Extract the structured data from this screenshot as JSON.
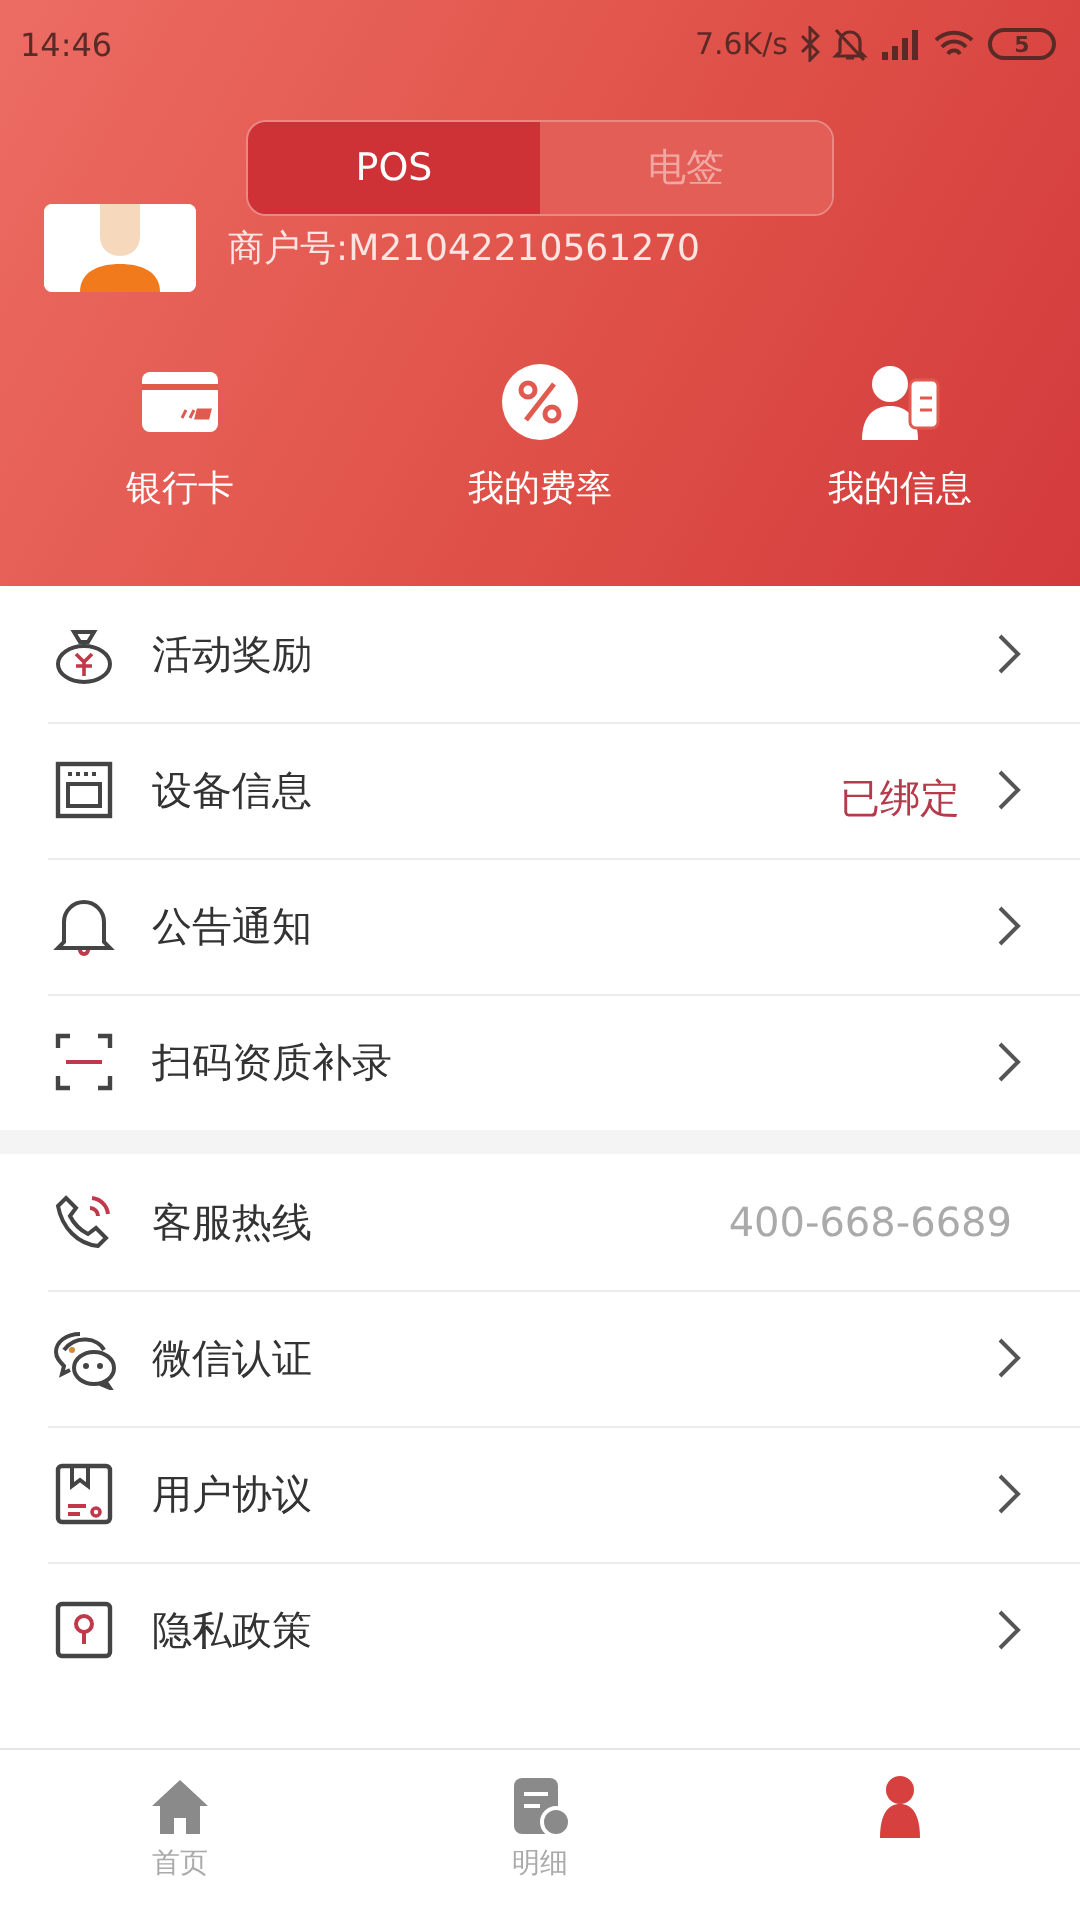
{
  "status_bar": {
    "time": "14:46",
    "network_speed": "7.6K/s",
    "battery": "5"
  },
  "segments": [
    {
      "label": "POS",
      "selected": true
    },
    {
      "label": "电签",
      "selected": false
    }
  ],
  "merchant": {
    "id_text": "商户号:M21042210561270"
  },
  "shortcuts": [
    {
      "label": "银行卡",
      "kind": "card"
    },
    {
      "label": "我的费率",
      "kind": "percent"
    },
    {
      "label": "我的信息",
      "kind": "profile"
    }
  ],
  "menu_groups": [
    {
      "items": [
        {
          "label": "活动奖励",
          "kind": "moneybag",
          "chevron": true
        },
        {
          "label": "设备信息",
          "kind": "device",
          "value": "已绑定",
          "chevron": true
        },
        {
          "label": "公告通知",
          "kind": "bell",
          "chevron": true
        },
        {
          "label": "扫码资质补录",
          "kind": "scan",
          "chevron": true
        }
      ]
    },
    {
      "items": [
        {
          "label": "客服热线",
          "kind": "phone",
          "value": "400-668-6689",
          "chevron": false
        },
        {
          "label": "微信认证",
          "kind": "chat",
          "chevron": true
        },
        {
          "label": "用户协议",
          "kind": "doc",
          "chevron": true
        },
        {
          "label": "隐私政策",
          "kind": "privacy",
          "chevron": true
        }
      ]
    }
  ],
  "bottom_nav": [
    {
      "label": "首页",
      "kind": "home",
      "selected": false
    },
    {
      "label": "明细",
      "kind": "bill",
      "selected": false
    },
    {
      "kind": "person",
      "selected": true
    }
  ]
}
